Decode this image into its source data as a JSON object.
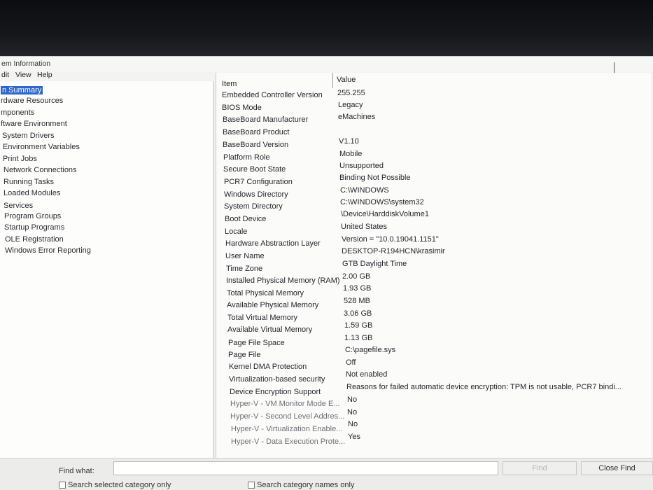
{
  "window": {
    "title": "em Information"
  },
  "menu": [
    "dit",
    "View",
    "Help"
  ],
  "tree": [
    {
      "label": "n Summary",
      "selected": true
    },
    {
      "label": "rdware Resources"
    },
    {
      "label": "mponents"
    },
    {
      "label": "ftware Environment"
    },
    {
      "label": "System Drivers"
    },
    {
      "label": "Environment Variables"
    },
    {
      "label": "Print Jobs"
    },
    {
      "label": "Network Connections"
    },
    {
      "label": "Running Tasks"
    },
    {
      "label": "Loaded Modules"
    },
    {
      "label": "Services"
    },
    {
      "label": "Program Groups"
    },
    {
      "label": "Startup Programs"
    },
    {
      "label": "OLE Registration"
    },
    {
      "label": "Windows Error Reporting"
    }
  ],
  "table": {
    "columns": [
      "Item",
      "Value"
    ],
    "rows": [
      {
        "item": "Embedded Controller Version",
        "value": "255.255"
      },
      {
        "item": "BIOS Mode",
        "value": "Legacy"
      },
      {
        "item": "BaseBoard Manufacturer",
        "value": "eMachines"
      },
      {
        "item": "BaseBoard Product",
        "value": ""
      },
      {
        "item": "BaseBoard Version",
        "value": "V1.10"
      },
      {
        "item": "Platform Role",
        "value": "Mobile"
      },
      {
        "item": "Secure Boot State",
        "value": "Unsupported"
      },
      {
        "item": "PCR7 Configuration",
        "value": "Binding Not Possible"
      },
      {
        "item": "Windows Directory",
        "value": "C:\\WINDOWS"
      },
      {
        "item": "System Directory",
        "value": "C:\\WINDOWS\\system32"
      },
      {
        "item": "Boot Device",
        "value": "\\Device\\HarddiskVolume1"
      },
      {
        "item": "Locale",
        "value": "United States"
      },
      {
        "item": "Hardware Abstraction Layer",
        "value": "Version = \"10.0.19041.1151\""
      },
      {
        "item": "User Name",
        "value": "DESKTOP-R194HCN\\krasimir"
      },
      {
        "item": "Time Zone",
        "value": "GTB Daylight Time"
      },
      {
        "item": "Installed Physical Memory (RAM)",
        "value": "2.00 GB"
      },
      {
        "item": "Total Physical Memory",
        "value": "1.93 GB"
      },
      {
        "item": "Available Physical Memory",
        "value": "528 MB"
      },
      {
        "item": "Total Virtual Memory",
        "value": "3.06 GB"
      },
      {
        "item": "Available Virtual Memory",
        "value": "1.59 GB"
      },
      {
        "item": "Page File Space",
        "value": "1.13 GB"
      },
      {
        "item": "Page File",
        "value": "C:\\pagefile.sys"
      },
      {
        "item": "Kernel DMA Protection",
        "value": "Off"
      },
      {
        "item": "Virtualization-based security",
        "value": "Not enabled"
      },
      {
        "item": "Device Encryption Support",
        "value": "Reasons for failed automatic device encryption: TPM is not usable, PCR7 bindi..."
      },
      {
        "item": "Hyper-V - VM Monitor Mode E...",
        "value": "No"
      },
      {
        "item": "Hyper-V - Second Level Addres...",
        "value": "No"
      },
      {
        "item": "Hyper-V - Virtualization Enable...",
        "value": "No"
      },
      {
        "item": "Hyper-V - Data Execution Prote...",
        "value": "Yes"
      }
    ]
  },
  "find": {
    "label": "Find what:",
    "value": "",
    "find_button": "Find",
    "close_button": "Close Find",
    "check_selected": "Search selected category only",
    "check_names": "Search category names only"
  },
  "colors": {
    "selection": "#2f66c9",
    "panel": "#fbfbfa"
  }
}
